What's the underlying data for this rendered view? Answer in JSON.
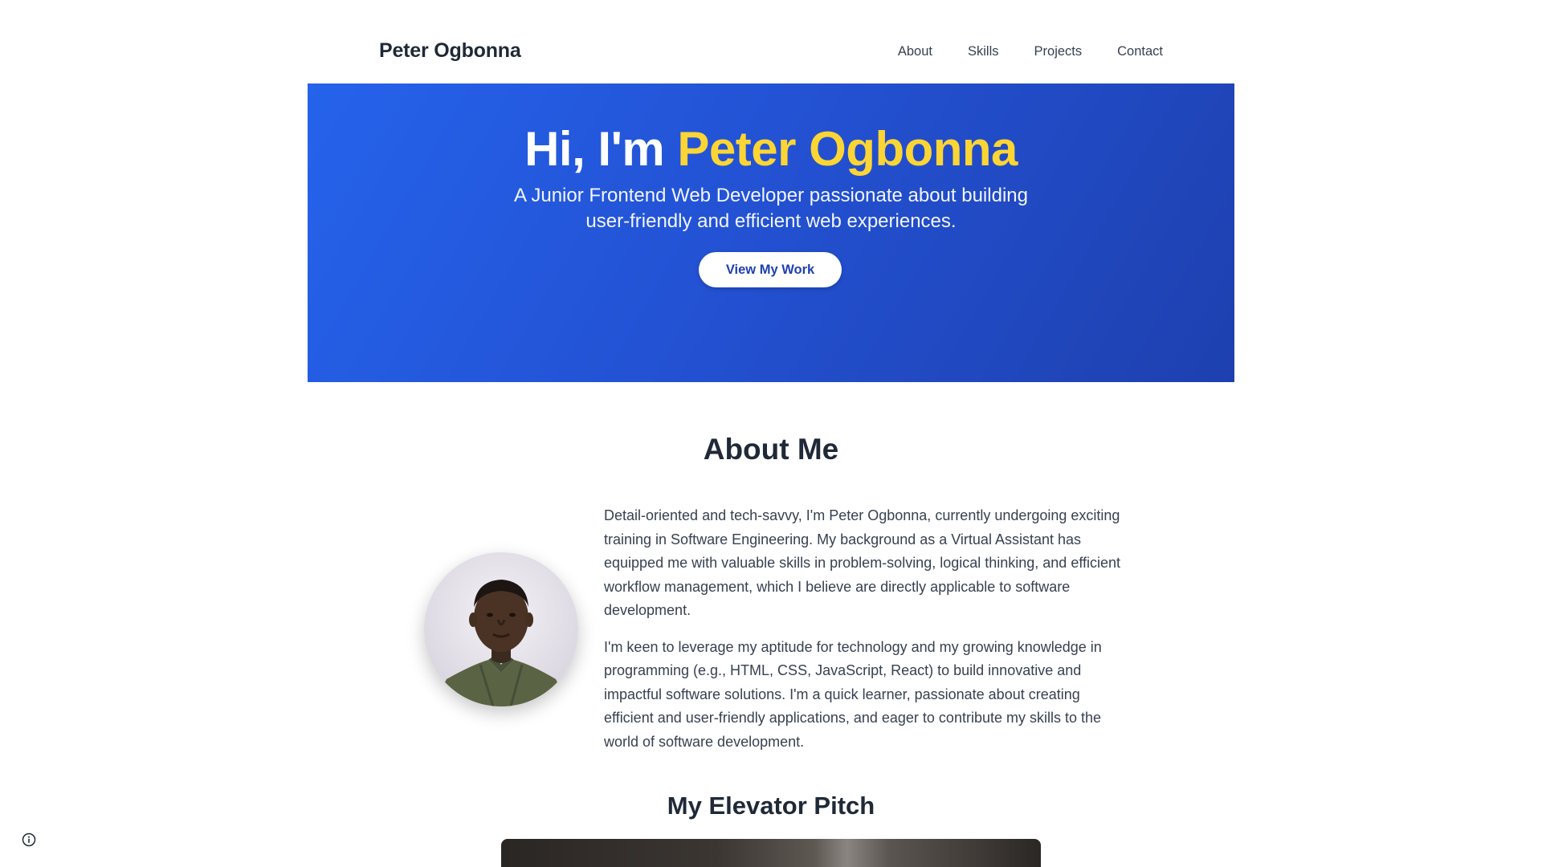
{
  "header": {
    "brand": "Peter Ogbonna",
    "nav": [
      "About",
      "Skills",
      "Projects",
      "Contact"
    ]
  },
  "hero": {
    "title_prefix": "Hi, I'm",
    "title_name": "Peter Ogbonna",
    "subtitle": "A Junior Frontend Web Developer passionate about building user-friendly and efficient web experiences.",
    "cta_label": "View My Work"
  },
  "about": {
    "title": "About Me",
    "paragraphs": [
      "Detail-oriented and tech-savvy, I'm Peter Ogbonna, currently undergoing exciting training in Software Engineering. My background as a Virtual Assistant has equipped me with valuable skills in problem-solving, logical thinking, and efficient workflow management, which I believe are directly applicable to software development.",
      "I'm keen to leverage my aptitude for technology and my growing knowledge in programming (e.g., HTML, CSS, JavaScript, React) to build innovative and impactful software solutions. I'm a quick learner, passionate about creating efficient and user-friendly applications, and eager to contribute my skills to the world of software development."
    ]
  },
  "pitch": {
    "title": "My Elevator Pitch"
  },
  "icons": {
    "info": "info-icon"
  },
  "colors": {
    "hero_start": "#2563eb",
    "hero_end": "#1e40af",
    "accent": "#fcd535",
    "text_dark": "#1f2937"
  }
}
